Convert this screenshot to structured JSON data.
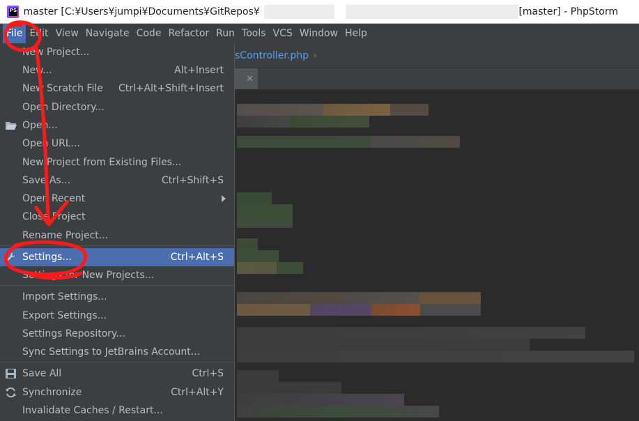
{
  "window": {
    "logo_text": "PS",
    "title_left": "master [C:¥Users¥jumpi¥Documents¥GitRepos¥",
    "title_right": "[master] - PhpStorm"
  },
  "menubar": {
    "items": [
      "File",
      "Edit",
      "View",
      "Navigate",
      "Code",
      "Refactor",
      "Run",
      "Tools",
      "VCS",
      "Window",
      "Help"
    ]
  },
  "navbar": {
    "file": "sController.php",
    "separator": "›"
  },
  "tab": {
    "close": "✕"
  },
  "file_menu": {
    "items": [
      {
        "label": "New Project...",
        "shortcut": ""
      },
      {
        "label": "New...",
        "shortcut": "Alt+Insert"
      },
      {
        "label": "New Scratch File",
        "shortcut": "Ctrl+Alt+Shift+Insert"
      },
      {
        "label": "Open Directory...",
        "shortcut": ""
      },
      {
        "label": "Open...",
        "shortcut": ""
      },
      {
        "label": "Open URL...",
        "shortcut": ""
      },
      {
        "label": "New Project from Existing Files...",
        "shortcut": ""
      },
      {
        "label": "Save As...",
        "shortcut": "Ctrl+Shift+S"
      },
      {
        "label": "Open Recent",
        "shortcut": ""
      },
      {
        "label": "Close Project",
        "shortcut": ""
      },
      {
        "label": "Rename Project...",
        "shortcut": ""
      },
      {
        "label": "Settings...",
        "shortcut": "Ctrl+Alt+S"
      },
      {
        "label": "Settings for New Projects...",
        "shortcut": ""
      },
      {
        "label": "Import Settings...",
        "shortcut": ""
      },
      {
        "label": "Export Settings...",
        "shortcut": ""
      },
      {
        "label": "Settings Repository...",
        "shortcut": ""
      },
      {
        "label": "Sync Settings to JetBrains Account...",
        "shortcut": ""
      },
      {
        "label": "Save All",
        "shortcut": "Ctrl+S"
      },
      {
        "label": "Synchronize",
        "shortcut": "Ctrl+Alt+Y"
      },
      {
        "label": "Invalidate Caches / Restart...",
        "shortcut": ""
      }
    ]
  },
  "colors": {
    "selection": "#4b6eaf",
    "menu_bg": "#3c3f41",
    "editor_bg": "#2b2b2b",
    "annotation": "#ff1a1a"
  }
}
